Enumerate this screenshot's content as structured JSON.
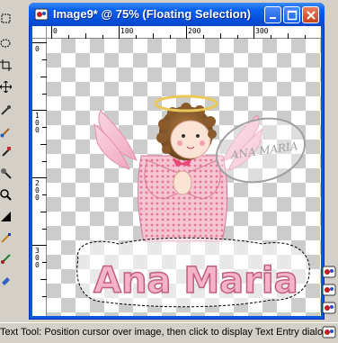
{
  "window": {
    "title": "Image9* @  75% (Floating Selection)",
    "icon": "psp-image-icon",
    "controls": [
      "minimize-icon",
      "maximize-icon",
      "close-icon"
    ]
  },
  "ruler": {
    "horizontal_labels": [
      "0",
      "100",
      "200",
      "300"
    ],
    "vertical_labels": [
      "0",
      "1 0 0",
      "2 0 0",
      "3 0 0"
    ]
  },
  "canvas": {
    "image": "angel-illustration",
    "text_content": "Ana Maria",
    "watermark": "ANA MARIA",
    "background": "transparency-checkerboard"
  },
  "toolbar": {
    "tools": [
      "selection-tool-icon",
      "crop-tool-icon",
      "move-tool-icon",
      "dropper-tool-icon",
      "paintbrush-tool-icon",
      "clone-tool-icon",
      "zoom-tool-icon",
      "fill-tool-icon",
      "text-tool-icon",
      "picture-tube-icon"
    ]
  },
  "statusbar": {
    "text": "Text Tool: Position cursor over image, then click to display Text Entry dialog."
  },
  "colors": {
    "titlebar": "#0a5ef0",
    "checker_dark": "#cccccc",
    "text_pink": "#f0a0b8"
  }
}
